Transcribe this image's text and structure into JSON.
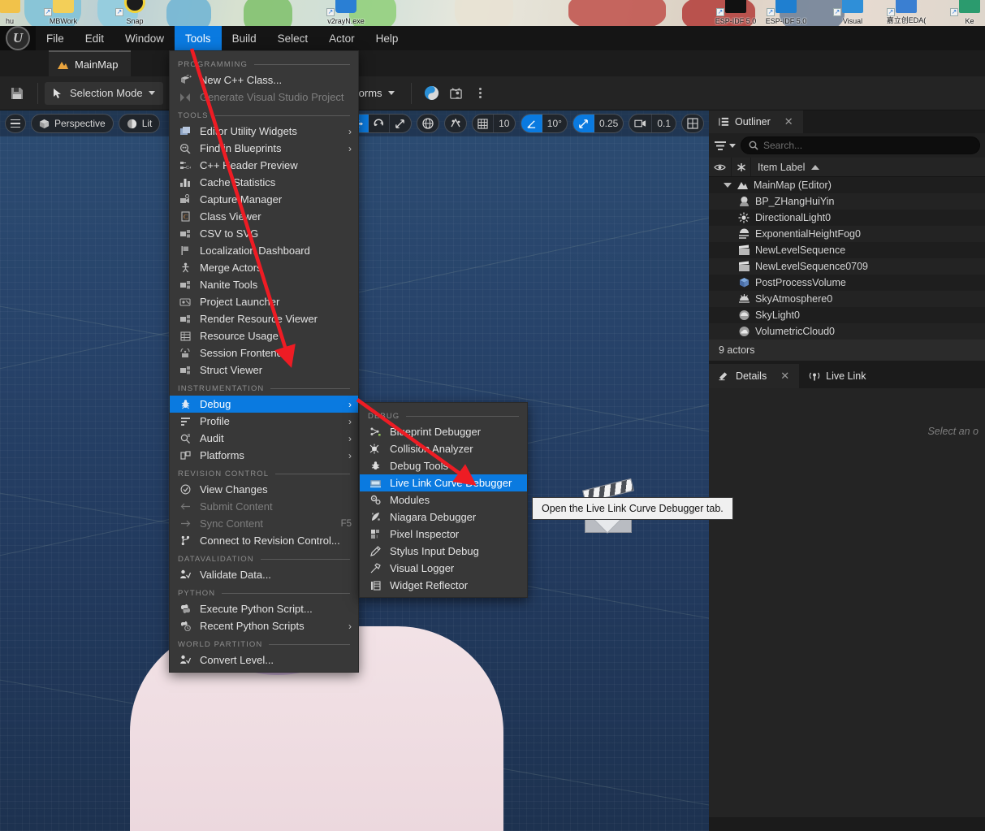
{
  "desktop": {
    "icons": [
      {
        "label": "hu",
        "color": "#f1c24a"
      },
      {
        "label": "MBWork",
        "color": "#f3cf58"
      },
      {
        "label": "Snap",
        "color": "#f2d338"
      },
      {
        "label": "v2rayN.exe",
        "color": "#2a7fd4"
      },
      {
        "label": "ESP-IDF 5.0",
        "color": "#111111"
      },
      {
        "label": "ESP-IDF 5.0",
        "color": "#1f7fd0"
      },
      {
        "label": "Visual",
        "color": "#2f8fd8"
      },
      {
        "label": "嘉立创EDA(",
        "color": "#3a7fd2"
      },
      {
        "label": "Ke",
        "color": "#2b9b6e"
      }
    ]
  },
  "menubar": {
    "logo_glyph": "U",
    "items": [
      {
        "label": "File",
        "active": false
      },
      {
        "label": "Edit",
        "active": false
      },
      {
        "label": "Window",
        "active": false
      },
      {
        "label": "Tools",
        "active": true
      },
      {
        "label": "Build",
        "active": false
      },
      {
        "label": "Select",
        "active": false
      },
      {
        "label": "Actor",
        "active": false
      },
      {
        "label": "Help",
        "active": false
      }
    ]
  },
  "tab": {
    "label": "MainMap"
  },
  "toolbar": {
    "save_icon": "save-icon",
    "mode_label": "Selection Mode",
    "play_icon": "play-icon",
    "step_icon": "step-icon",
    "stop_icon": "stop-icon",
    "eject_icon": "eject-icon",
    "settings_icon": "kebab-icon",
    "platforms_label": "Platforms",
    "yin_yang_icon": "yinyang-icon",
    "tv_icon": "tv-user-icon"
  },
  "viewport": {
    "hamburger": "viewport-menu-icon",
    "perspective_label": "Perspective",
    "lit_label": "Lit",
    "grid_snap_value": "10",
    "angle_snap_value": "10°",
    "scale_snap_value": "0.25",
    "camera_speed_value": "0.1",
    "gizmo": {
      "select": "select-cursor-icon",
      "translate": "translate-gizmo-icon",
      "rotate": "rotate-gizmo-icon",
      "scale": "scale-gizmo-icon"
    },
    "coord_icon": "world-coordinate-icon",
    "surface_snap_icon": "surface-snap-icon",
    "actor_clapper": "level-sequence-actor-icon"
  },
  "tools_menu": {
    "sections": [
      {
        "title": "PROGRAMMING",
        "items": [
          {
            "label": "New C++ Class...",
            "icon": "cpp-class-icon",
            "disabled": false,
            "submenu": false,
            "shortcut": ""
          },
          {
            "label": "Generate Visual Studio Project",
            "icon": "vs-project-icon",
            "disabled": true,
            "submenu": false,
            "shortcut": ""
          }
        ]
      },
      {
        "title": "TOOLS",
        "items": [
          {
            "label": "Editor Utility Widgets",
            "icon": "widget-icon",
            "disabled": false,
            "submenu": true,
            "shortcut": ""
          },
          {
            "label": "Find in Blueprints",
            "icon": "find-blueprint-icon",
            "disabled": false,
            "submenu": true,
            "shortcut": ""
          },
          {
            "label": "C++ Header Preview",
            "icon": "cpp-header-icon",
            "disabled": false,
            "submenu": false,
            "shortcut": ""
          },
          {
            "label": "Cache Statistics",
            "icon": "bar-chart-icon",
            "disabled": false,
            "submenu": false,
            "shortcut": ""
          },
          {
            "label": "Capture Manager",
            "icon": "capture-icon",
            "disabled": false,
            "submenu": false,
            "shortcut": ""
          },
          {
            "label": "Class Viewer",
            "icon": "class-viewer-icon",
            "disabled": false,
            "submenu": false,
            "shortcut": ""
          },
          {
            "label": "CSV to SVG",
            "icon": "csv-svg-icon",
            "disabled": false,
            "submenu": false,
            "shortcut": ""
          },
          {
            "label": "Localization Dashboard",
            "icon": "flag-icon",
            "disabled": false,
            "submenu": false,
            "shortcut": ""
          },
          {
            "label": "Merge Actors",
            "icon": "merge-actors-icon",
            "disabled": false,
            "submenu": false,
            "shortcut": ""
          },
          {
            "label": "Nanite Tools",
            "icon": "nanite-icon",
            "disabled": false,
            "submenu": false,
            "shortcut": ""
          },
          {
            "label": "Project Launcher",
            "icon": "launcher-icon",
            "disabled": false,
            "submenu": false,
            "shortcut": ""
          },
          {
            "label": "Render Resource Viewer",
            "icon": "render-resource-icon",
            "disabled": false,
            "submenu": false,
            "shortcut": ""
          },
          {
            "label": "Resource Usage",
            "icon": "table-icon",
            "disabled": false,
            "submenu": false,
            "shortcut": ""
          },
          {
            "label": "Session Frontend",
            "icon": "session-frontend-icon",
            "disabled": false,
            "submenu": false,
            "shortcut": ""
          },
          {
            "label": "Struct Viewer",
            "icon": "struct-viewer-icon",
            "disabled": false,
            "submenu": false,
            "shortcut": ""
          }
        ]
      },
      {
        "title": "INSTRUMENTATION",
        "items": [
          {
            "label": "Debug",
            "icon": "bug-icon",
            "disabled": false,
            "submenu": true,
            "selected": true,
            "shortcut": ""
          },
          {
            "label": "Profile",
            "icon": "profile-icon",
            "disabled": false,
            "submenu": true,
            "shortcut": ""
          },
          {
            "label": "Audit",
            "icon": "audit-icon",
            "disabled": false,
            "submenu": true,
            "shortcut": ""
          },
          {
            "label": "Platforms",
            "icon": "platforms-icon",
            "disabled": false,
            "submenu": true,
            "shortcut": ""
          }
        ]
      },
      {
        "title": "REVISION CONTROL",
        "items": [
          {
            "label": "View Changes",
            "icon": "check-circle-icon",
            "disabled": false,
            "submenu": false,
            "shortcut": ""
          },
          {
            "label": "Submit Content",
            "icon": "arrow-left-icon",
            "disabled": true,
            "submenu": false,
            "shortcut": ""
          },
          {
            "label": "Sync Content",
            "icon": "arrow-right-icon",
            "disabled": true,
            "submenu": false,
            "shortcut": "F5"
          },
          {
            "label": "Connect to Revision Control...",
            "icon": "branch-icon",
            "disabled": false,
            "submenu": false,
            "shortcut": ""
          }
        ]
      },
      {
        "title": "DATAVALIDATION",
        "items": [
          {
            "label": "Validate Data...",
            "icon": "validate-icon",
            "disabled": false,
            "submenu": false,
            "shortcut": ""
          }
        ]
      },
      {
        "title": "PYTHON",
        "items": [
          {
            "label": "Execute Python Script...",
            "icon": "python-icon",
            "disabled": false,
            "submenu": false,
            "shortcut": ""
          },
          {
            "label": "Recent Python Scripts",
            "icon": "python-recent-icon",
            "disabled": false,
            "submenu": true,
            "shortcut": ""
          }
        ]
      },
      {
        "title": "WORLD PARTITION",
        "items": [
          {
            "label": "Convert Level...",
            "icon": "convert-level-icon",
            "disabled": false,
            "submenu": false,
            "shortcut": ""
          }
        ]
      }
    ]
  },
  "debug_menu": {
    "title": "DEBUG",
    "items": [
      {
        "label": "Blueprint Debugger",
        "icon": "blueprint-debugger-icon",
        "selected": false
      },
      {
        "label": "Collision Analyzer",
        "icon": "collision-analyzer-icon",
        "selected": false
      },
      {
        "label": "Debug Tools",
        "icon": "debug-tools-icon",
        "selected": false
      },
      {
        "label": "Live Link Curve Debugger",
        "icon": "live-link-curve-icon",
        "selected": true
      },
      {
        "label": "Modules",
        "icon": "modules-icon",
        "selected": false
      },
      {
        "label": "Niagara Debugger",
        "icon": "niagara-debugger-icon",
        "selected": false
      },
      {
        "label": "Pixel Inspector",
        "icon": "pixel-inspector-icon",
        "selected": false
      },
      {
        "label": "Stylus Input Debug",
        "icon": "stylus-input-icon",
        "selected": false
      },
      {
        "label": "Visual Logger",
        "icon": "visual-logger-icon",
        "selected": false
      },
      {
        "label": "Widget Reflector",
        "icon": "widget-reflector-icon",
        "selected": false
      }
    ]
  },
  "tooltip": {
    "text": "Open the Live Link Curve Debugger tab."
  },
  "outliner": {
    "tab_label": "Outliner",
    "tab_icon": "outliner-icon",
    "close_icon": "close-icon",
    "filter_icon": "filter-icon",
    "search_placeholder": "Search...",
    "search_value": "",
    "columns": {
      "visibility": "eye-icon",
      "pin": "star-icon",
      "label": "Item Label",
      "sort": "sort-ascending-icon"
    },
    "rows": [
      {
        "label": "MainMap (Editor)",
        "icon": "level-icon",
        "depth": 0,
        "expanded": true
      },
      {
        "label": "BP_ZHangHuiYin",
        "icon": "blueprint-actor-icon",
        "depth": 1
      },
      {
        "label": "DirectionalLight0",
        "icon": "directional-light-icon",
        "depth": 1
      },
      {
        "label": "ExponentialHeightFog0",
        "icon": "height-fog-icon",
        "depth": 1
      },
      {
        "label": "NewLevelSequence",
        "icon": "level-sequence-icon",
        "depth": 1
      },
      {
        "label": "NewLevelSequence0709",
        "icon": "level-sequence-icon",
        "depth": 1
      },
      {
        "label": "PostProcessVolume",
        "icon": "post-process-volume-icon",
        "depth": 1
      },
      {
        "label": "SkyAtmosphere0",
        "icon": "sky-atmosphere-icon",
        "depth": 1
      },
      {
        "label": "SkyLight0",
        "icon": "sky-light-icon",
        "depth": 1
      },
      {
        "label": "VolumetricCloud0",
        "icon": "volumetric-cloud-icon",
        "depth": 1
      }
    ],
    "status": "9 actors"
  },
  "details": {
    "tab_label": "Details",
    "tab_icon": "details-icon",
    "close_icon": "close-icon",
    "live_link_tab_label": "Live Link",
    "live_link_icon": "live-link-icon",
    "hint": "Select an o"
  },
  "colors": {
    "accent_blue": "#0a7ae0",
    "annotation_red": "#ee1c24",
    "panel_bg": "#1e1e1e",
    "menu_bg": "#383838",
    "viewport_top": "#2c4c72",
    "viewport_bottom": "#1d3250"
  }
}
